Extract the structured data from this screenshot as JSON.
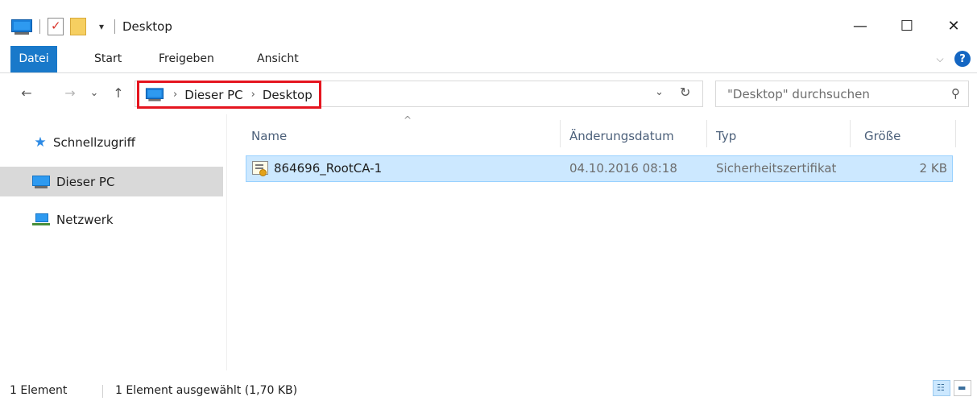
{
  "window": {
    "title": "Desktop",
    "minimize_glyph": "—",
    "maximize_glyph": "☐",
    "close_glyph": "✕",
    "qat_dropdown_glyph": "▾"
  },
  "ribbon": {
    "tabs": [
      "Datei",
      "Start",
      "Freigeben",
      "Ansicht"
    ],
    "active_tab": "Datei",
    "active_color": "#1979ca",
    "expand_glyph": "⌵",
    "help_glyph": "?"
  },
  "nav": {
    "back_glyph": "←",
    "forward_glyph": "→",
    "recent_glyph": "⌄",
    "up_glyph": "↑"
  },
  "address": {
    "path": [
      "Dieser PC",
      "Desktop"
    ],
    "separator": "›",
    "dropdown_glyph": "⌄",
    "refresh_glyph": "↻",
    "highlight_color": "#e5151f"
  },
  "search": {
    "placeholder": "\"Desktop\" durchsuchen",
    "icon_glyph": "⚲"
  },
  "navigation_pane": {
    "items": [
      {
        "label": "Schnellzugriff",
        "icon": "star-icon",
        "selected": false
      },
      {
        "label": "Dieser PC",
        "icon": "pc-icon",
        "selected": true
      },
      {
        "label": "Netzwerk",
        "icon": "network-icon",
        "selected": false
      }
    ]
  },
  "file_list": {
    "sort_glyph": "^",
    "columns": [
      "Name",
      "Änderungsdatum",
      "Typ",
      "Größe"
    ],
    "rows": [
      {
        "name": "864696_RootCA-1",
        "modified": "04.10.2016 08:18",
        "type": "Sicherheitszertifikat",
        "size": "2 KB",
        "icon": "certificate-icon",
        "selected": true
      }
    ]
  },
  "status_bar": {
    "item_count": "1 Element",
    "selection": "1 Element ausgewählt (1,70 KB)",
    "details_view_glyph": "☷",
    "large_icons_glyph": "▬"
  }
}
